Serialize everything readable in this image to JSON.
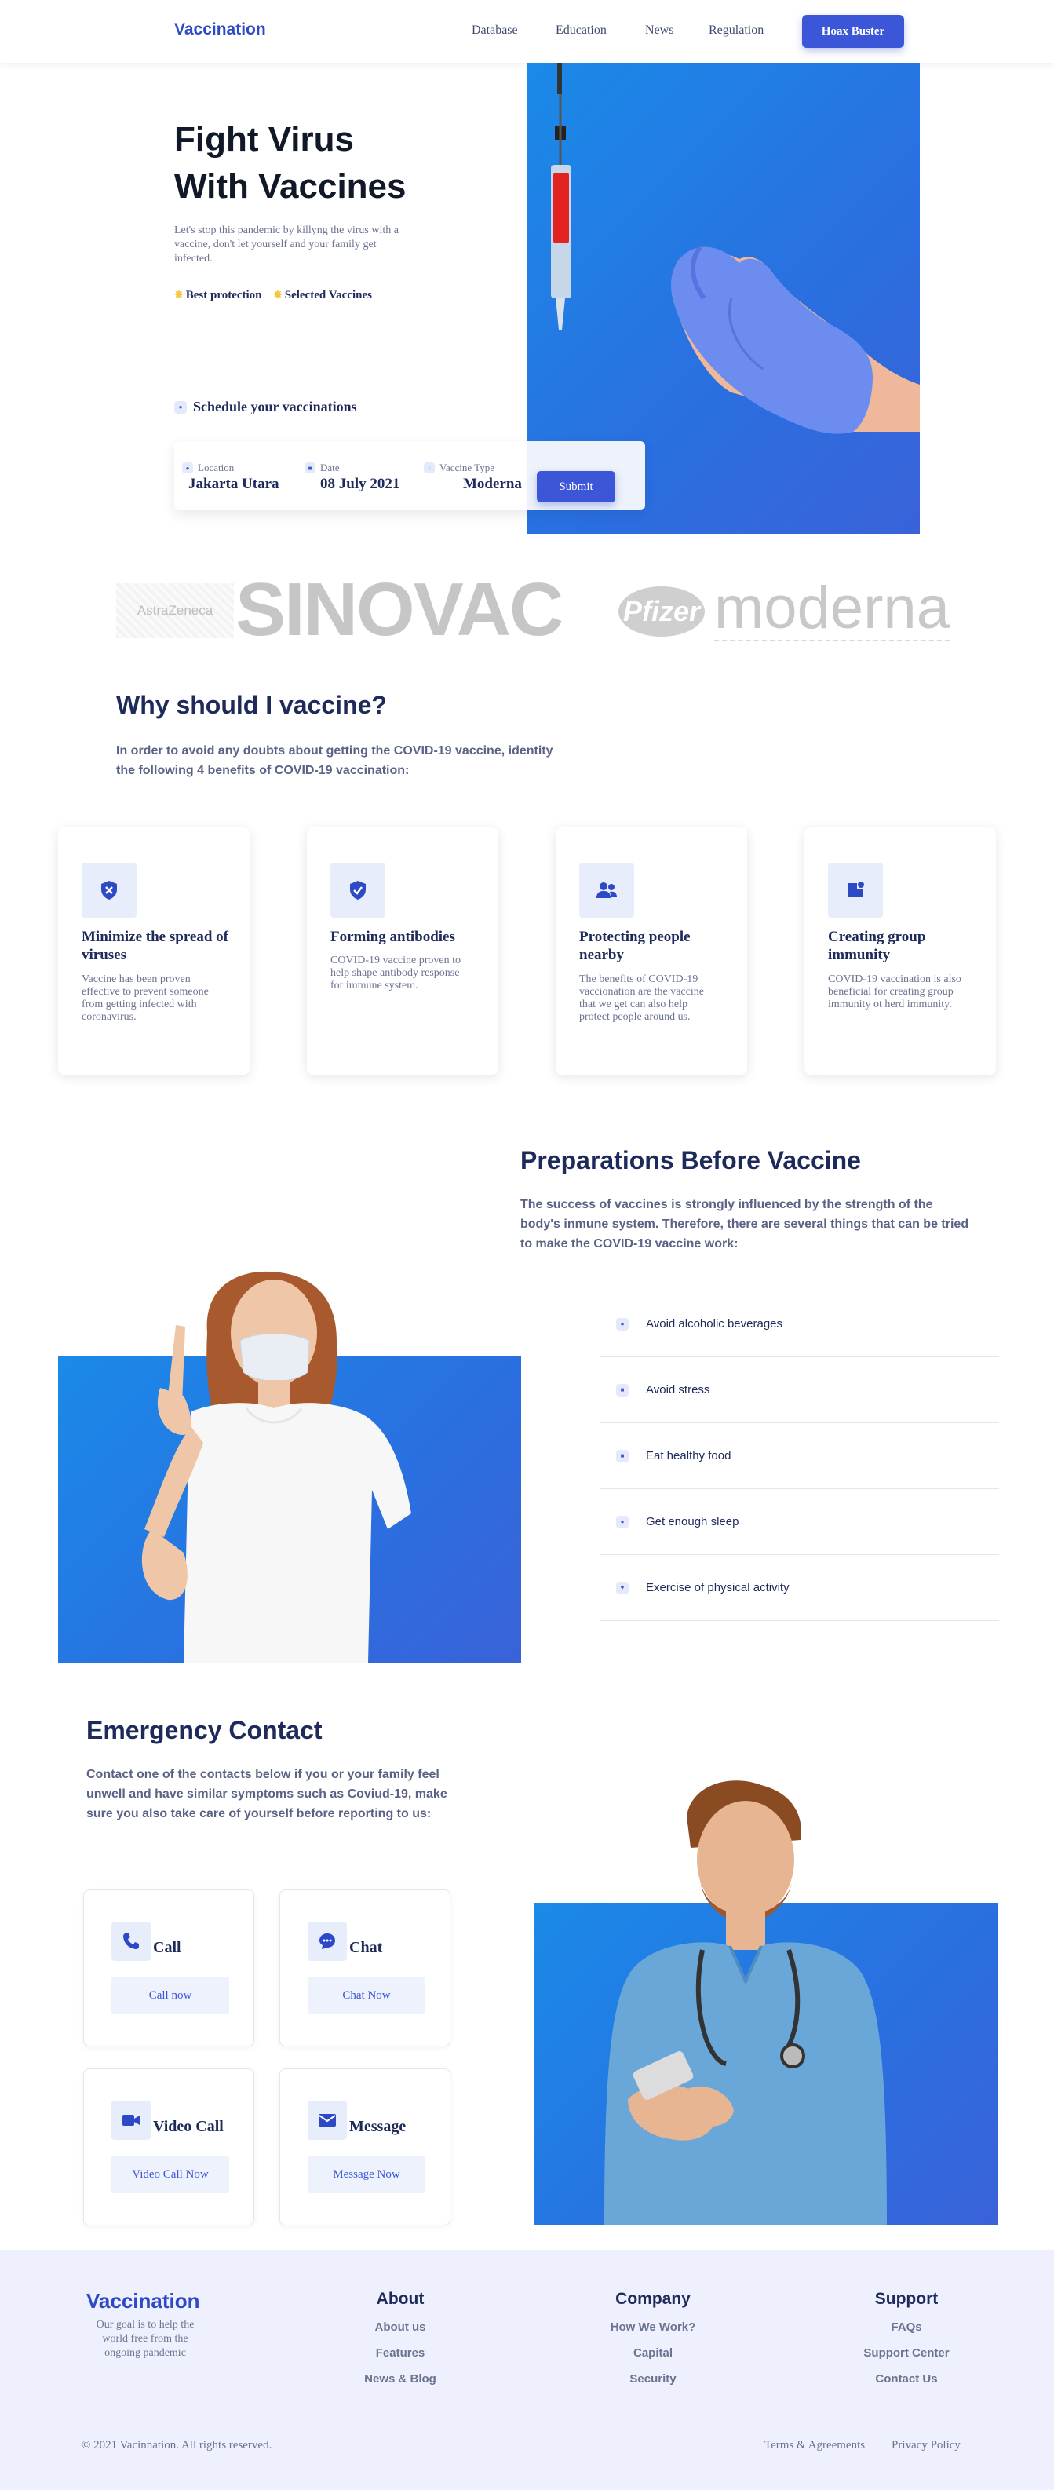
{
  "nav": {
    "brand": "Vaccination",
    "links": [
      "Database",
      "Education",
      "News",
      "Regulation"
    ],
    "cta": "Hoax Buster"
  },
  "hero": {
    "title_line1": "Fight Virus",
    "title_line2": "With Vaccines",
    "description": "Let's stop this pandemic by killyng the virus with a vaccine, don't let yourself and your family get infected.",
    "feature1": "Best protection",
    "feature2": "Selected Vaccines",
    "schedule": "Schedule your vaccinations"
  },
  "form": {
    "location_label": "Location",
    "location_value": "Jakarta Utara",
    "date_label": "Date",
    "date_value": "08 July 2021",
    "type_label": "Vaccine Type",
    "type_value": "Moderna",
    "submit": "Submit"
  },
  "logos": [
    "AstraZeneca",
    "SINOVAC",
    "Pfizer",
    "moderna"
  ],
  "why": {
    "title": "Why should I vaccine?",
    "description": "In order to avoid any doubts about getting the COVID-19 vaccine, identity the following 4 benefits of COVID-19 vaccination:",
    "cards": [
      {
        "icon": "shield-virus-icon",
        "title": "Minimize the spread of viruses",
        "text": "Vaccine has been proven effective to prevent someone from getting infected with coronavirus."
      },
      {
        "icon": "shield-check-icon",
        "title": "Forming antibodies",
        "text": "COVID-19 vaccine proven to help shape antibody response for immune system."
      },
      {
        "icon": "people-icon",
        "title": "Protecting people nearby",
        "text": "The benefits of COVID-19 vaccionation are the vaccine that we get can also help protect people around us."
      },
      {
        "icon": "group-icon",
        "title": "Creating group immunity",
        "text": "COVID-19 vaccination is also beneficial for creating group immunity ot herd immunity."
      }
    ]
  },
  "prep": {
    "title": "Preparations Before Vaccine",
    "description": "The success of vaccines is strongly influenced by the strength of the body's inmune system. Therefore, there are several things that can be tried to make the COVID-19 vaccine work:",
    "items": [
      "Avoid alcoholic beverages",
      "Avoid stress",
      "Eat healthy food",
      "Get enough sleep",
      "Exercise of physical activity"
    ]
  },
  "emergency": {
    "title": "Emergency Contact",
    "description": "Contact one of the contacts below if you or your family feel unwell and have similar symptoms such as Coviud-19, make sure you also take care of yourself before reporting to us:",
    "contacts": [
      {
        "icon": "phone-icon",
        "name": "Call",
        "button": "Call now"
      },
      {
        "icon": "chat-icon",
        "name": "Chat",
        "button": "Chat Now"
      },
      {
        "icon": "video-icon",
        "name": "Video Call",
        "button": "Video Call Now"
      },
      {
        "icon": "mail-icon",
        "name": "Message",
        "button": "Message Now"
      }
    ]
  },
  "footer": {
    "brand": "Vaccination",
    "about": "Our goal is to help the world free from the ongoing pandemic",
    "columns": [
      {
        "title": "About",
        "links": [
          "About us",
          "Features",
          "News & Blog"
        ]
      },
      {
        "title": "Company",
        "links": [
          "How We Work?",
          "Capital",
          "Security"
        ]
      },
      {
        "title": "Support",
        "links": [
          "FAQs",
          "Support Center",
          "Contact Us"
        ]
      }
    ],
    "copyright": "© 2021 Vacinnation. All rights reserved.",
    "terms": "Terms & Agreements",
    "privacy": "Privacy Policy"
  },
  "colors": {
    "accent": "#3b56d6",
    "brand": "#2d49c6",
    "dark": "#1e2a5a",
    "image_blue": "#1a8ae8"
  }
}
